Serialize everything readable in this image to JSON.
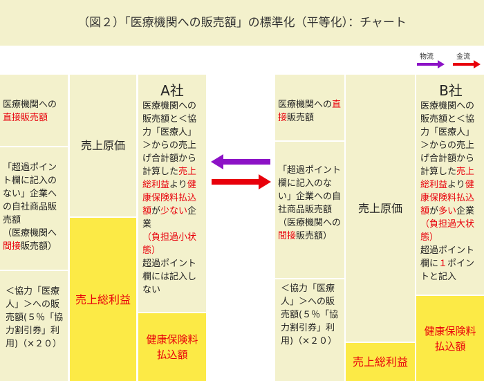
{
  "title": "（図２）「医療機関への販売額」の標準化（平等化）：チャート",
  "legend": {
    "goods_label": "物流",
    "money_label": "金流",
    "goods_color": "#8c12c6",
    "money_color": "#e8000b"
  },
  "colors": {
    "panel": "#f3f1cc",
    "profit": "#fcea46",
    "highlight": "#e8000b"
  },
  "company_a": {
    "direct_prefix": "医療機関への",
    "direct_highlight": "直接販売額",
    "indirect_1": "「超過ポイント欄に記入のない」企業への自社商品販売額",
    "indirect_2": "（医療機関へ",
    "indirect_hl": "間接",
    "indirect_3": "販売額）",
    "kyoryoku": "＜協力「医療人」＞への販売額(５％「協力割引券」利用)（×２０）",
    "cost": "売上原価",
    "profit": "売上総利益",
    "name": "A社",
    "desc_1": "医療機関への販売額と＜協力「医療人」＞からの売上げ合計額から計算した",
    "desc_hl1": "売上総利益",
    "desc_2": "より",
    "desc_hl2": "健康保険料払込額",
    "desc_3": "が",
    "desc_hl3": "少ない",
    "desc_4": "企業",
    "desc_hl4": "（負担過小状態）",
    "desc_5": "超過ポイント欄には記入しない",
    "insurance": "健康保険料払込額"
  },
  "company_b": {
    "direct_prefix": "医療機関への",
    "direct_highlight": "直接",
    "direct_suffix": "販売額",
    "indirect_1": "「超過ポイント欄に記入のない」企業への自社商品販売額",
    "indirect_2": "（医療機関への",
    "indirect_hl": "間接",
    "indirect_3": "販売額）",
    "kyoryoku": "＜協力「医療人」＞への販売額(５％「協力割引券」利用)（×２０）",
    "cost": "売上原価",
    "profit": "売上総利益",
    "name": "B社",
    "desc_1": "医療機関への販売額と＜協力「医療人」＞からの売上げ合計額から計算した",
    "desc_hl1": "売上総利益",
    "desc_2": "より",
    "desc_hl2": "健康保険料払込額",
    "desc_3": "が",
    "desc_hl3": "多い",
    "desc_4": "企業",
    "desc_hl4": "（負担過大状態）",
    "desc_5": "超過ポイント欄に",
    "desc_hl5": "１",
    "desc_6": "ポイントと記入",
    "insurance": "健康保険料払込額"
  }
}
